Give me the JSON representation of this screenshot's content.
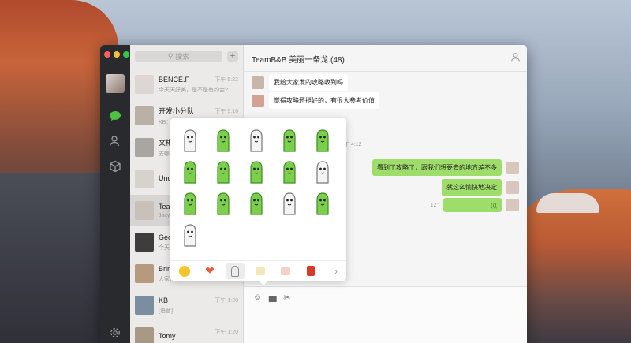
{
  "search": {
    "placeholder": "搜索"
  },
  "chat_list": [
    {
      "name": "BENCE.F",
      "preview": "今天天好美，是不是有约会?",
      "time": "下午 5:22",
      "avatar_color": "#ddd6d2"
    },
    {
      "name": "开发小分队",
      "preview": "KB：…",
      "time": "下午 5:16",
      "avatar_color": "#b9b0a6"
    },
    {
      "name": "文彬",
      "preview": "去哪…",
      "time": "",
      "avatar_color": "#a9a6a2"
    },
    {
      "name": "Undo",
      "preview": "",
      "time": "",
      "avatar_color": "#d8d2cc"
    },
    {
      "name": "TeamB&B",
      "preview": "Jacy…",
      "time": "",
      "avatar_color": "#c9c0b9"
    },
    {
      "name": "Georg…",
      "preview": "今天…",
      "time": "",
      "avatar_color": "#3d3d3d"
    },
    {
      "name": "Brindi…",
      "preview": "大家…",
      "time": "",
      "avatar_color": "#b69a80"
    },
    {
      "name": "KB",
      "preview": "[语音]",
      "time": "下午 1:28",
      "avatar_color": "#7a8e9f"
    },
    {
      "name": "Tomy",
      "preview": "",
      "time": "下午 1:20",
      "avatar_color": "#a89886"
    }
  ],
  "conversation": {
    "title": "TeamB&B 美丽一条龙 (48)",
    "messages_in": [
      {
        "text": "我给大家发的攻略收到吗"
      },
      {
        "text": "觉得攻略还挺好的，有很大参考价值"
      }
    ],
    "timestamp": "下午 4:12",
    "messages_out": [
      {
        "text": "看到了攻略了，跟我们想要去的地方差不多"
      },
      {
        "text": "就这么愉快地决定"
      },
      {
        "text": "",
        "duration": "12\""
      }
    ]
  },
  "colors": {
    "accent": "#4fc142",
    "bubble_out": "#9fdd6a",
    "rail": "#282a2d"
  },
  "icons": {
    "rail": [
      "chat-icon",
      "contacts-icon",
      "favorites-icon",
      "settings-icon"
    ],
    "composer": [
      "emoji-icon",
      "folder-icon",
      "scissors-icon"
    ]
  }
}
